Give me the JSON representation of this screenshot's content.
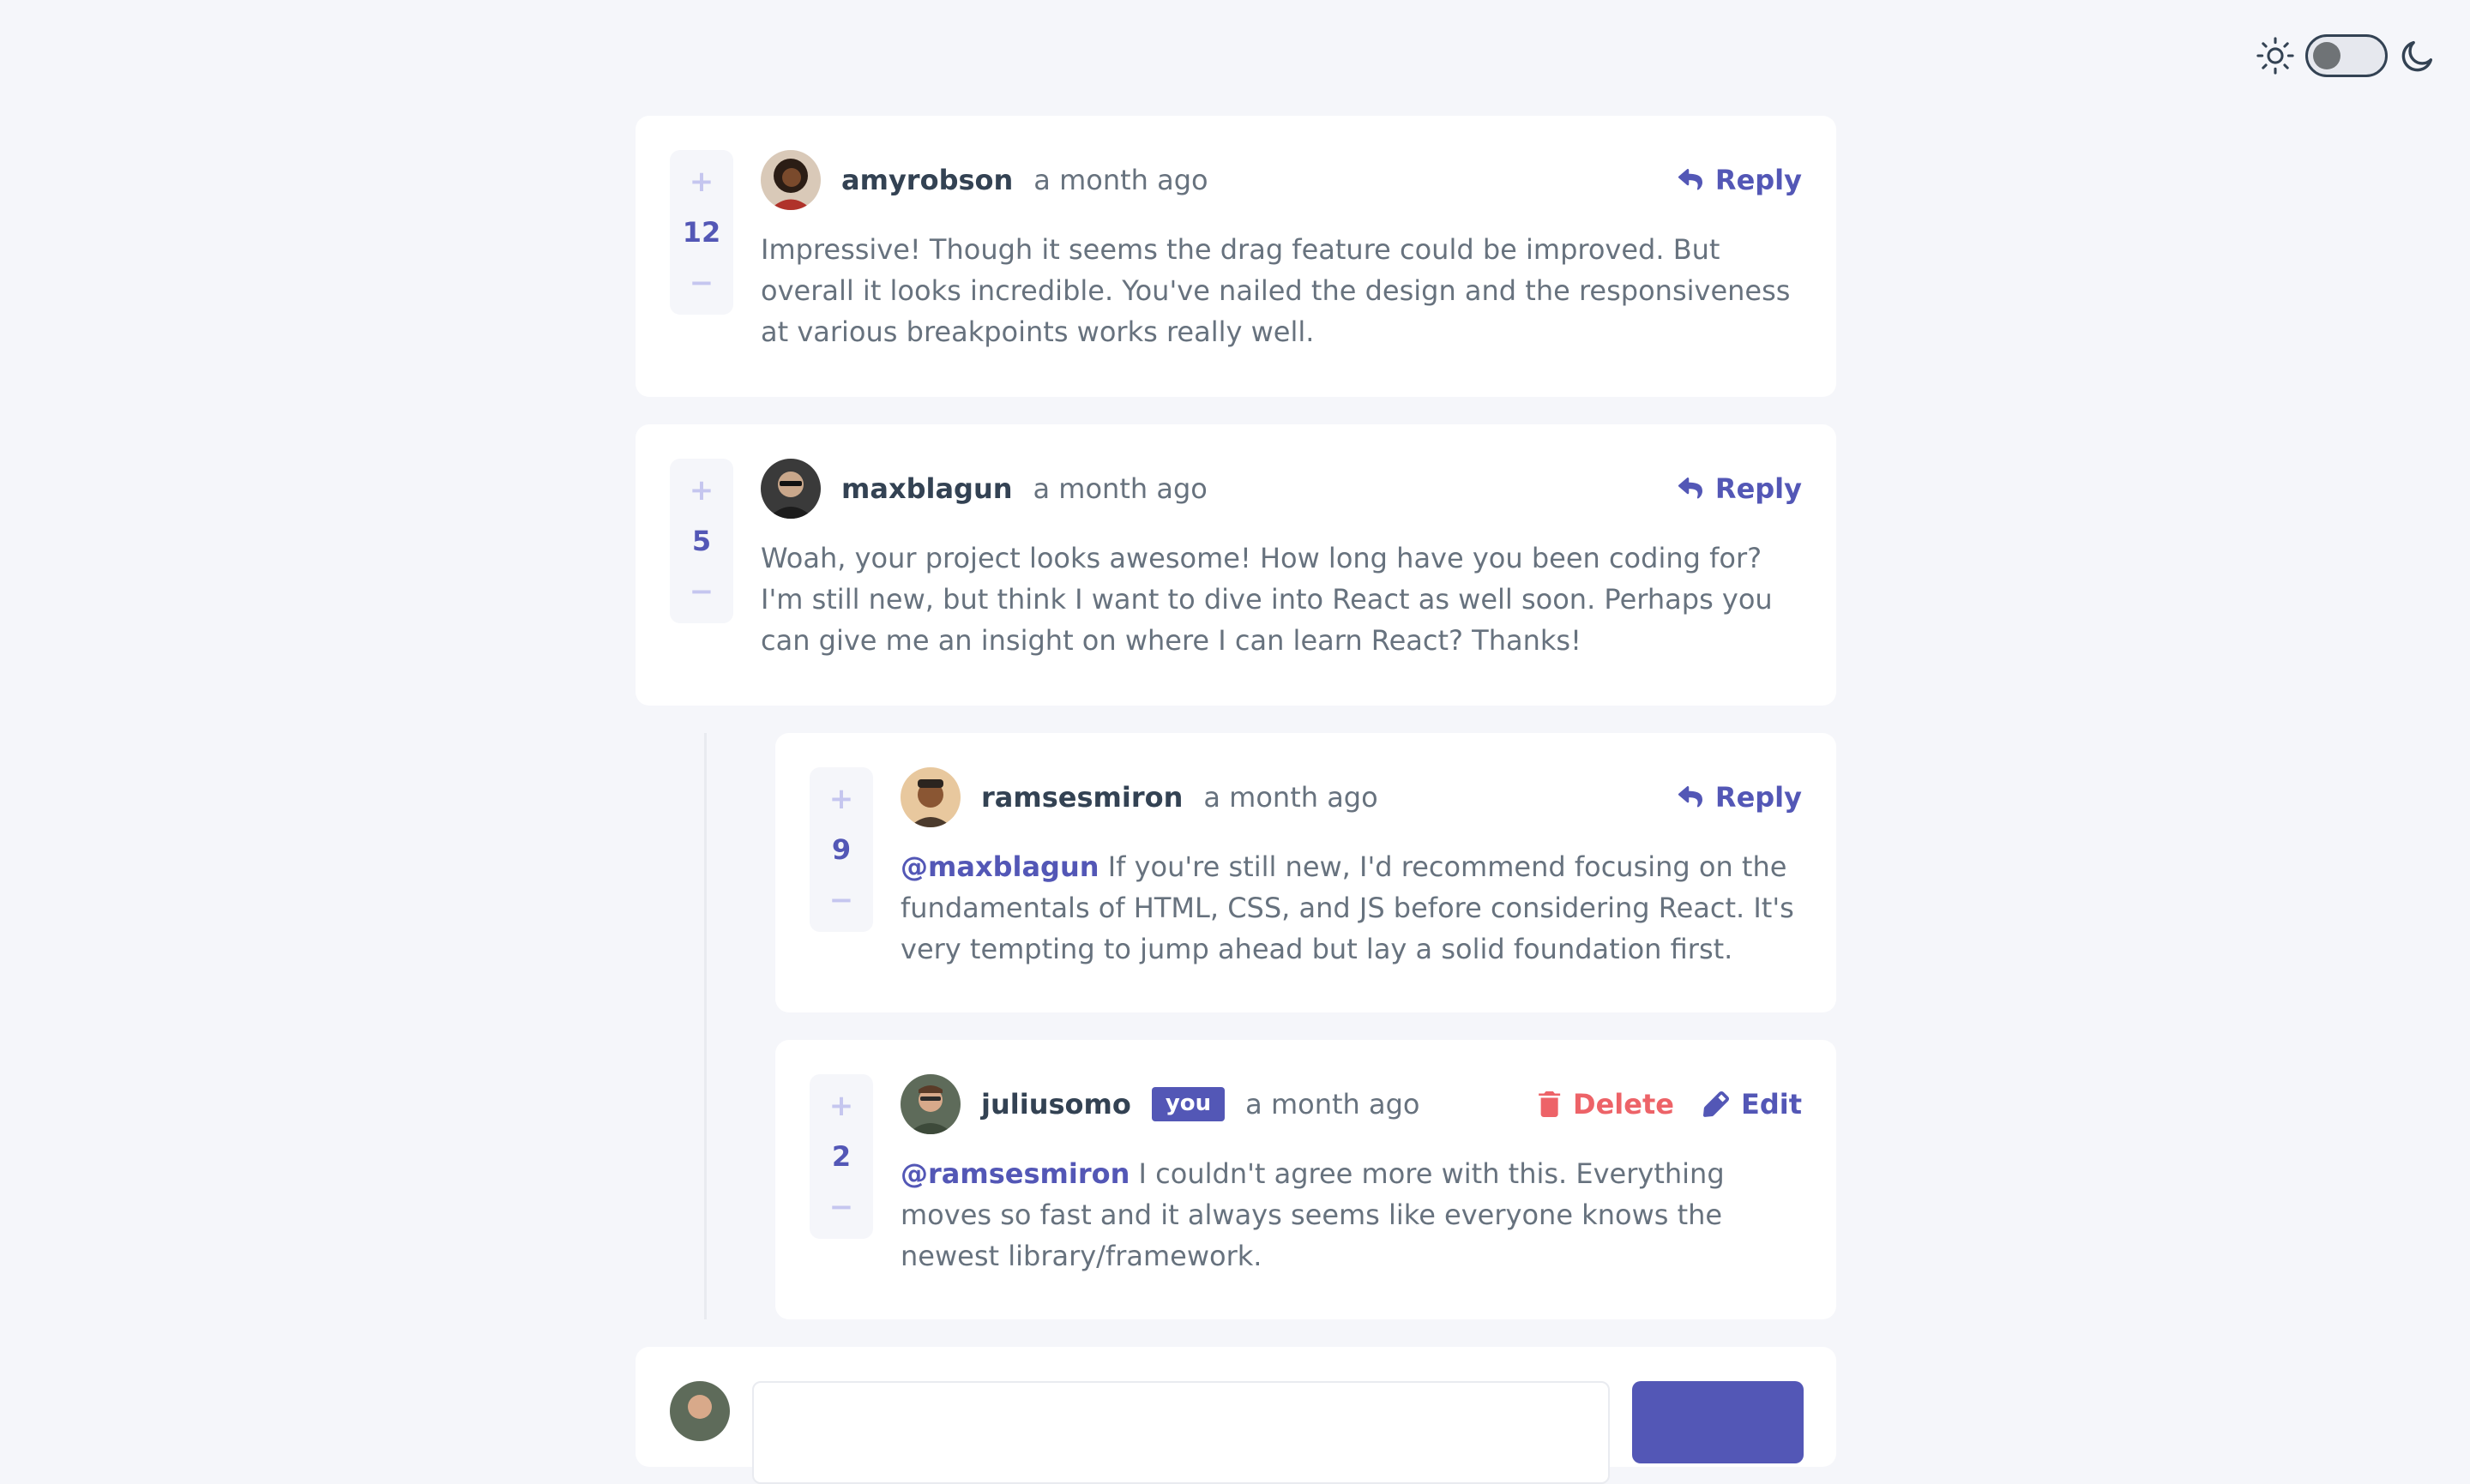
{
  "colors": {
    "background": "#f5f6fa",
    "card": "#ffffff",
    "primary": "#5357b6",
    "vote_light": "#c5c6ef",
    "danger": "#ed6368",
    "heading": "#334253",
    "text": "#67727e"
  },
  "theme_toggle": {
    "light_icon": "sun-icon",
    "dark_icon": "moon-icon",
    "state": "light"
  },
  "comments": [
    {
      "username": "amyrobson",
      "time": "a month ago",
      "score": "12",
      "action_label": "Reply",
      "text": "Impressive! Though it seems the drag feature could be improved. But overall it looks incredible. You've nailed the design and the responsiveness at various breakpoints works really well."
    },
    {
      "username": "maxblagun",
      "time": "a month ago",
      "score": "5",
      "action_label": "Reply",
      "text": "Woah, your project looks awesome! How long have you been coding for? I'm still new, but think I want to dive into React as well soon. Perhaps you can give me an insight on where I can learn React? Thanks!",
      "replies": [
        {
          "username": "ramsesmiron",
          "time": "a month ago",
          "score": "9",
          "action_label": "Reply",
          "mention": "@maxblagun",
          "text": " If you're still new, I'd recommend focusing on the fundamentals of HTML, CSS, and JS before considering React. It's very tempting to jump ahead but lay a solid foundation first."
        },
        {
          "username": "juliusomo",
          "you_badge": "you",
          "time": "a month ago",
          "score": "2",
          "delete_label": "Delete",
          "edit_label": "Edit",
          "mention": "@ramsesmiron",
          "text": " I couldn't agree more with this. Everything moves so fast and it always seems like everyone knows the newest library/framework."
        }
      ]
    }
  ],
  "vote": {
    "plus": "+",
    "minus": "−"
  }
}
